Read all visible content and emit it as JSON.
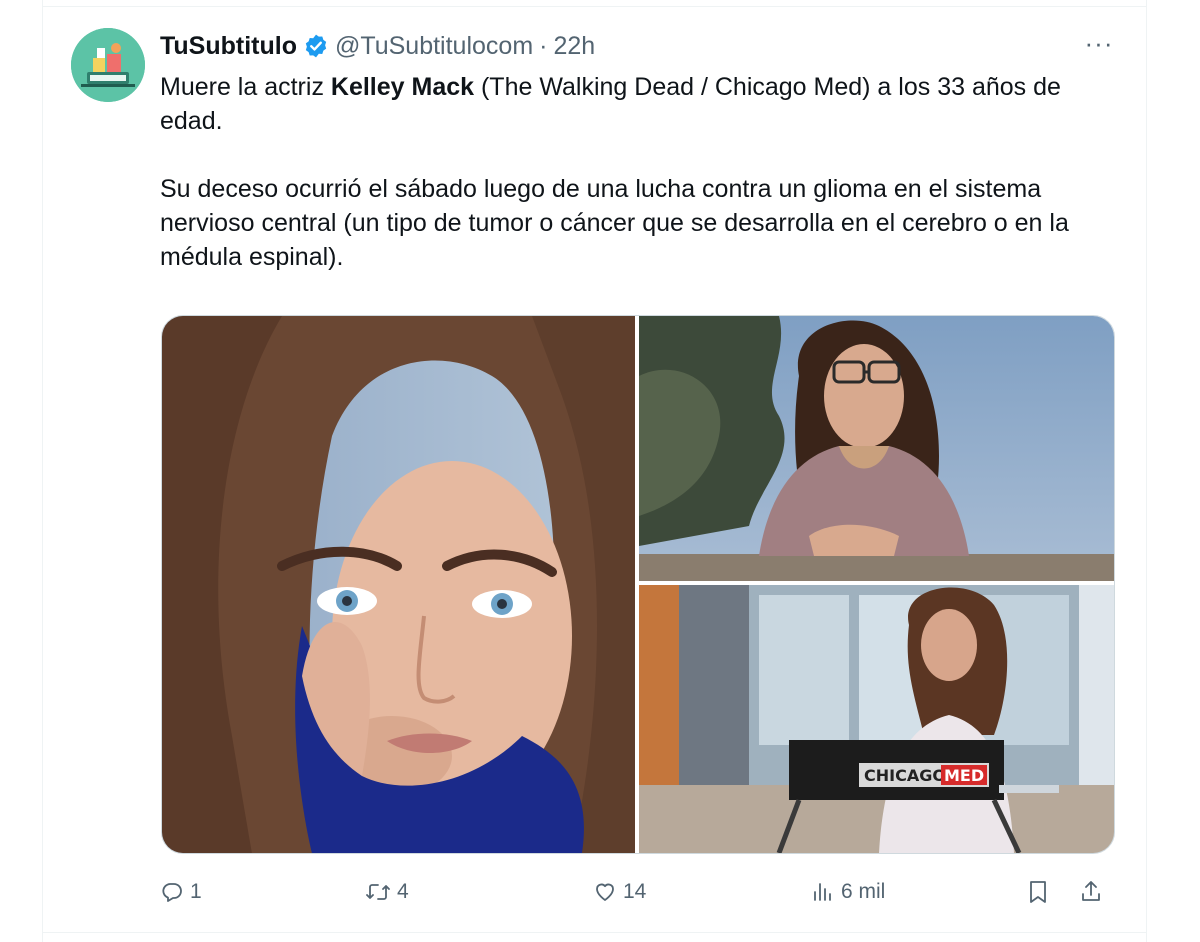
{
  "tweet": {
    "display_name": "TuSubtitulo",
    "handle": "@TuSubtitulocom",
    "separator": "·",
    "time": "22h",
    "more_label": "···",
    "text": {
      "p1_before": "Muere la actriz ",
      "p1_bold": "Kelley Mack",
      "p1_after": " (The Walking Dead / Chicago Med) a los 33 años de edad.",
      "p2": "Su deceso ocurrió el sábado luego de una lucha contra un glioma en el sistema nervioso central (un tipo de tumor o cáncer que se desarrolla en el cerebro o en la médula espinal)."
    },
    "media": {
      "chair_text": [
        "CHICAGO",
        "MED"
      ]
    },
    "actions": {
      "replies": "1",
      "retweets": "4",
      "likes": "14",
      "views": "6 mil"
    }
  },
  "icons": {
    "verified": "verified-badge-icon",
    "reply": "reply-icon",
    "retweet": "retweet-icon",
    "like": "heart-icon",
    "views": "views-bar-chart-icon",
    "bookmark": "bookmark-icon",
    "share": "share-icon"
  },
  "colors": {
    "verified_blue": "#1d9bf0",
    "secondary_text": "#536471",
    "primary_text": "#0f1419",
    "avatar_bg": "#5cc3a6"
  }
}
